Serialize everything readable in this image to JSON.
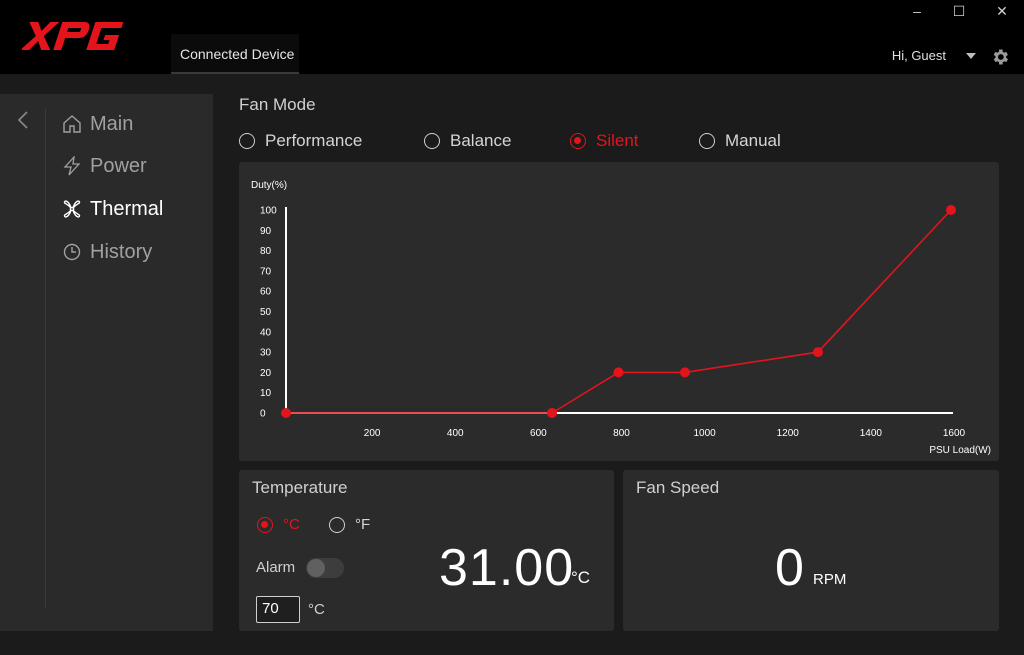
{
  "app": {
    "logo_text": "XPG"
  },
  "header": {
    "connected_tab": "Connected Device",
    "user_greeting": "Hi, Guest",
    "window_controls": {
      "minimize": "–",
      "maximize": "☐",
      "close": "✕"
    }
  },
  "sidebar": {
    "items": [
      {
        "label": "Main",
        "icon": "home-icon",
        "active": false
      },
      {
        "label": "Power",
        "icon": "bolt-icon",
        "active": false
      },
      {
        "label": "Thermal",
        "icon": "fan-icon",
        "active": true
      },
      {
        "label": "History",
        "icon": "clock-icon",
        "active": false
      }
    ]
  },
  "fan_mode": {
    "title": "Fan Mode",
    "options": [
      "Performance",
      "Balance",
      "Silent",
      "Manual"
    ],
    "selected": "Silent"
  },
  "chart_data": {
    "type": "line",
    "ylabel": "Duty(%)",
    "xlabel": "PSU Load(W)",
    "x_ticks": [
      200,
      400,
      600,
      800,
      1000,
      1200,
      1400,
      1600
    ],
    "y_ticks": [
      0,
      10,
      20,
      30,
      40,
      50,
      60,
      70,
      80,
      90,
      100
    ],
    "xlim": [
      0,
      1600
    ],
    "ylim": [
      0,
      100
    ],
    "series": [
      {
        "color": "#e3141c",
        "points": [
          {
            "x": 0,
            "y": 0
          },
          {
            "x": 640,
            "y": 0
          },
          {
            "x": 800,
            "y": 20
          },
          {
            "x": 960,
            "y": 20
          },
          {
            "x": 1280,
            "y": 30
          },
          {
            "x": 1600,
            "y": 100
          }
        ]
      }
    ]
  },
  "temperature": {
    "title": "Temperature",
    "units": [
      "°C",
      "°F"
    ],
    "selected_unit": "°C",
    "alarm_label": "Alarm",
    "alarm_enabled": false,
    "alarm_value": "70",
    "alarm_unit": "°C",
    "value": "31.00",
    "value_unit": "°C"
  },
  "fan_speed": {
    "title": "Fan Speed",
    "value": "0",
    "unit": "RPM"
  },
  "colors": {
    "accent": "#e3141c",
    "panel": "#2b2b2b",
    "sidebar": "#2a2a2a",
    "background": "#1b1b1b"
  }
}
